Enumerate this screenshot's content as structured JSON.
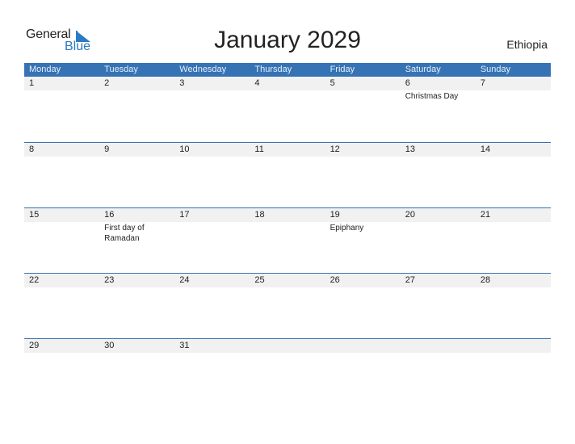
{
  "logo": {
    "line1": "General",
    "line2": "Blue"
  },
  "title": "January 2029",
  "country": "Ethiopia",
  "colors": {
    "header_bg": "#3573b5",
    "accent": "#2a7bc4",
    "day_row_bg": "#f1f1f1"
  },
  "weekdays": [
    "Monday",
    "Tuesday",
    "Wednesday",
    "Thursday",
    "Friday",
    "Saturday",
    "Sunday"
  ],
  "weeks": [
    [
      {
        "day": "1",
        "event": ""
      },
      {
        "day": "2",
        "event": ""
      },
      {
        "day": "3",
        "event": ""
      },
      {
        "day": "4",
        "event": ""
      },
      {
        "day": "5",
        "event": ""
      },
      {
        "day": "6",
        "event": "Christmas Day"
      },
      {
        "day": "7",
        "event": ""
      }
    ],
    [
      {
        "day": "8",
        "event": ""
      },
      {
        "day": "9",
        "event": ""
      },
      {
        "day": "10",
        "event": ""
      },
      {
        "day": "11",
        "event": ""
      },
      {
        "day": "12",
        "event": ""
      },
      {
        "day": "13",
        "event": ""
      },
      {
        "day": "14",
        "event": ""
      }
    ],
    [
      {
        "day": "15",
        "event": ""
      },
      {
        "day": "16",
        "event": "First day of Ramadan"
      },
      {
        "day": "17",
        "event": ""
      },
      {
        "day": "18",
        "event": ""
      },
      {
        "day": "19",
        "event": "Epiphany"
      },
      {
        "day": "20",
        "event": ""
      },
      {
        "day": "21",
        "event": ""
      }
    ],
    [
      {
        "day": "22",
        "event": ""
      },
      {
        "day": "23",
        "event": ""
      },
      {
        "day": "24",
        "event": ""
      },
      {
        "day": "25",
        "event": ""
      },
      {
        "day": "26",
        "event": ""
      },
      {
        "day": "27",
        "event": ""
      },
      {
        "day": "28",
        "event": ""
      }
    ],
    [
      {
        "day": "29",
        "event": ""
      },
      {
        "day": "30",
        "event": ""
      },
      {
        "day": "31",
        "event": ""
      },
      {
        "day": "",
        "event": ""
      },
      {
        "day": "",
        "event": ""
      },
      {
        "day": "",
        "event": ""
      },
      {
        "day": "",
        "event": ""
      }
    ]
  ]
}
